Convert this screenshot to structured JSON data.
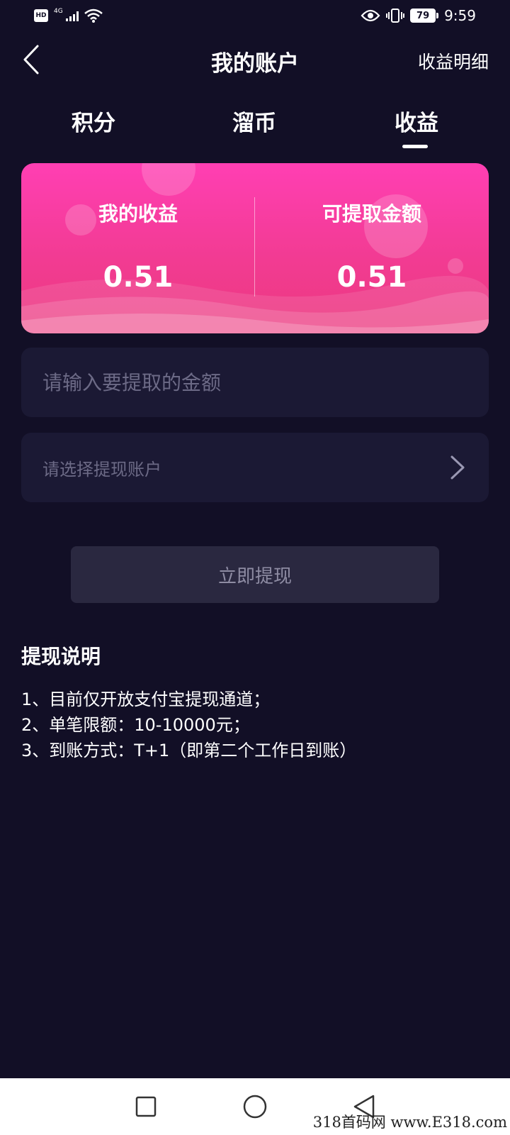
{
  "status_bar": {
    "hd": "HD",
    "network": "4G",
    "battery": "79",
    "time": "9:59"
  },
  "header": {
    "title": "我的账户",
    "detail_link": "收益明细"
  },
  "tabs": [
    {
      "label": "积分",
      "active": false
    },
    {
      "label": "溜币",
      "active": false
    },
    {
      "label": "收益",
      "active": true
    }
  ],
  "earnings_card": {
    "my_earnings_label": "我的收益",
    "my_earnings_value": "0.51",
    "withdrawable_label": "可提取金额",
    "withdrawable_value": "0.51"
  },
  "form": {
    "amount_placeholder": "请输入要提取的金额",
    "account_placeholder": "请选择提现账户",
    "withdraw_button": "立即提现"
  },
  "notes": {
    "title": "提现说明",
    "items": [
      "1、目前仅开放支付宝提现通道；",
      "2、单笔限额：10-10000元；",
      "3、到账方式：T+1（即第二个工作日到账）"
    ]
  },
  "watermark": "318首码网 www.E318.com",
  "colors": {
    "background": "#120f26",
    "card_gradient_top": "#ff3fb3",
    "card_gradient_bottom": "#ec3a7f",
    "field_background": "#1b1934",
    "button_background": "#2a2840"
  },
  "icons": {
    "back": "chevron-left-icon",
    "account_select": "chevron-right-icon",
    "nav_recent": "square-icon",
    "nav_home": "circle-icon",
    "nav_back": "triangle-back-icon"
  }
}
